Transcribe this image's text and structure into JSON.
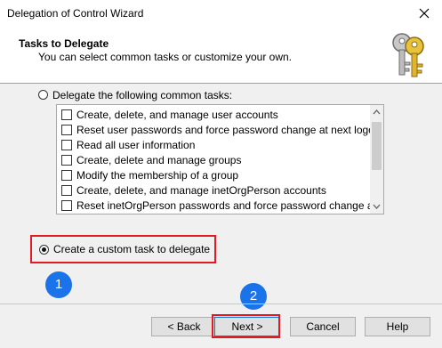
{
  "window": {
    "title": "Delegation of Control Wizard"
  },
  "header": {
    "title": "Tasks to Delegate",
    "subtitle": "You can select common tasks or customize your own.",
    "icon": "keys-icon"
  },
  "option_common": {
    "label": "Delegate the following common tasks:",
    "selected": false
  },
  "tasks": [
    {
      "label": "Create, delete, and manage user accounts",
      "checked": false
    },
    {
      "label": "Reset user passwords and force password change at next logon",
      "checked": false
    },
    {
      "label": "Read all user information",
      "checked": false
    },
    {
      "label": "Create, delete and manage groups",
      "checked": false
    },
    {
      "label": "Modify the membership of a group",
      "checked": false
    },
    {
      "label": "Create, delete, and manage inetOrgPerson accounts",
      "checked": false
    },
    {
      "label": "Reset inetOrgPerson passwords and force password change at next lo",
      "checked": false
    }
  ],
  "option_custom": {
    "label": "Create a custom task to delegate",
    "selected": true
  },
  "annotations": {
    "step1": "1",
    "step2": "2",
    "highlight_color": "#e21b23",
    "badge_color": "#1a73e8"
  },
  "buttons": {
    "back": "< Back",
    "next": "Next >",
    "cancel": "Cancel",
    "help": "Help"
  }
}
